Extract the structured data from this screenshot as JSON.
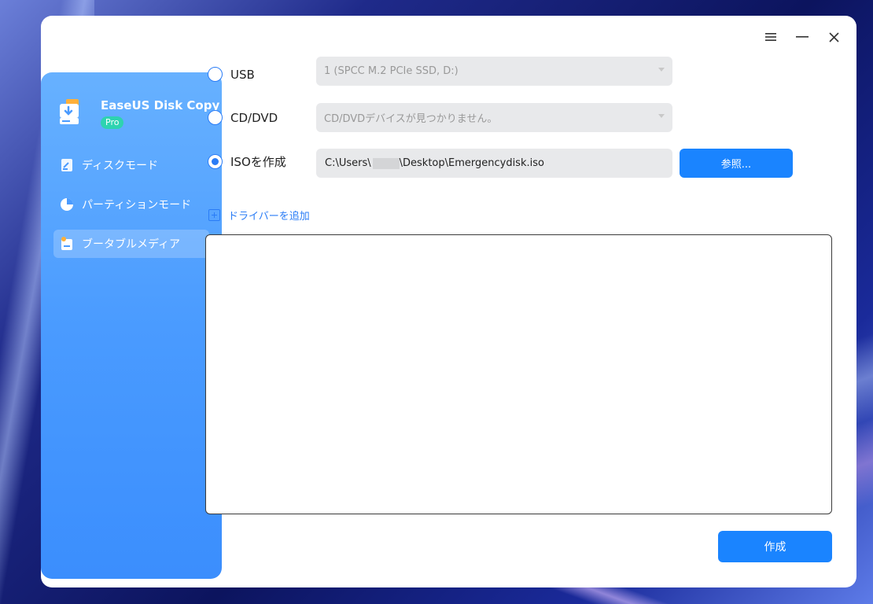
{
  "app": {
    "name": "EaseUS Disk Copy",
    "edition_badge": "Pro"
  },
  "sidebar": {
    "items": [
      {
        "label": "ディスクモード",
        "icon": "disk-icon",
        "active": false
      },
      {
        "label": "パーティションモード",
        "icon": "pie-chart-icon",
        "active": false
      },
      {
        "label": "ブータブルメディア",
        "icon": "bootable-media-icon",
        "active": true
      }
    ]
  },
  "window_controls": {
    "menu_icon": "hamburger-menu-icon",
    "minimize_icon": "minimize-icon",
    "close_icon": "close-icon"
  },
  "options": {
    "usb": {
      "label": "USB",
      "checked": false,
      "selected_device": "1 (SPCC M.2 PCIe SSD, D:)"
    },
    "cddvd": {
      "label": "CD/DVD",
      "checked": false,
      "selected_device": "CD/DVDデバイスが見つかりません。"
    },
    "iso": {
      "label": "ISOを作成",
      "checked": true,
      "path_prefix": "C:\\Users\\",
      "path_suffix": "\\Desktop\\Emergencydisk.iso"
    }
  },
  "browse_button": "参照...",
  "add_driver_label": "ドライバーを追加",
  "create_button": "作成",
  "colors": {
    "accent": "#1a84ff",
    "sidebar_top": "#67b1ff",
    "sidebar_bottom": "#3b8efd",
    "badge": "#2ed3b0"
  }
}
